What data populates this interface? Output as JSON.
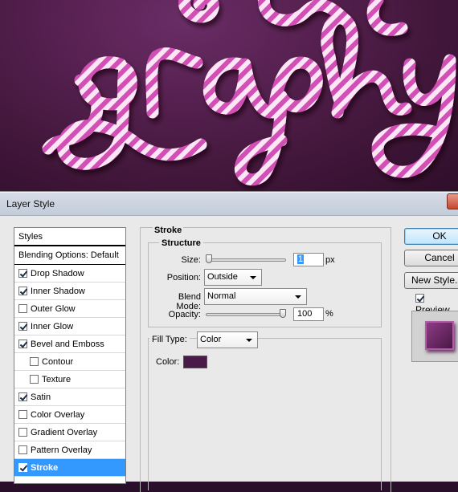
{
  "dialog": {
    "title": "Layer Style"
  },
  "styles_list": {
    "header": "Styles",
    "blending_options": "Blending Options: Default",
    "items": [
      {
        "label": "Drop Shadow",
        "checked": true,
        "indent": false
      },
      {
        "label": "Inner Shadow",
        "checked": true,
        "indent": false
      },
      {
        "label": "Outer Glow",
        "checked": false,
        "indent": false
      },
      {
        "label": "Inner Glow",
        "checked": true,
        "indent": false
      },
      {
        "label": "Bevel and Emboss",
        "checked": true,
        "indent": false
      },
      {
        "label": "Contour",
        "checked": false,
        "indent": true
      },
      {
        "label": "Texture",
        "checked": false,
        "indent": true
      },
      {
        "label": "Satin",
        "checked": true,
        "indent": false
      },
      {
        "label": "Color Overlay",
        "checked": false,
        "indent": false
      },
      {
        "label": "Gradient Overlay",
        "checked": false,
        "indent": false
      },
      {
        "label": "Pattern Overlay",
        "checked": false,
        "indent": false
      },
      {
        "label": "Stroke",
        "checked": true,
        "indent": false,
        "selected": true
      }
    ]
  },
  "stroke": {
    "title": "Stroke",
    "structure_title": "Structure",
    "size_label": "Size:",
    "size_value": "1",
    "size_unit": "px",
    "size_slider_fraction": 0.0,
    "position_label": "Position:",
    "position_value": "Outside",
    "blend_mode_label": "Blend Mode:",
    "blend_mode_value": "Normal",
    "opacity_label": "Opacity:",
    "opacity_value": "100",
    "opacity_unit": "%",
    "opacity_slider_fraction": 1.0,
    "fill_type_label": "Fill Type:",
    "fill_type_value": "Color",
    "color_label": "Color:",
    "color_value": "#4a1a48"
  },
  "buttons": {
    "ok": "OK",
    "cancel": "Cancel",
    "new_style": "New Style...",
    "preview_label": "Preview",
    "preview_checked": true
  },
  "colors": {
    "selection": "#3399ff",
    "candy_pink": "#d24fb5",
    "candy_white": "#fbe6f6",
    "background": "#55204f"
  },
  "artwork": {
    "text": "graphy"
  }
}
